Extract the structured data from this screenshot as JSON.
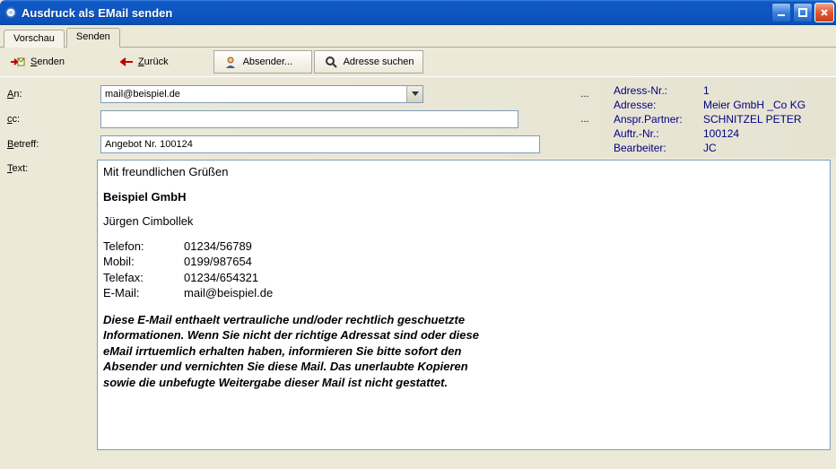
{
  "window": {
    "title": "Ausdruck als EMail senden"
  },
  "tabs": {
    "preview": "Vorschau",
    "send": "Senden"
  },
  "toolbar": {
    "send": "Senden",
    "back": "Zurück",
    "sender": "Absender...",
    "search": "Adresse suchen"
  },
  "form": {
    "labels": {
      "to": "An:",
      "cc": "cc:",
      "subject": "Betreff:",
      "text": "Text:",
      "ellipsis": "..."
    },
    "to_value": "mail@beispiel.de",
    "cc_value": "",
    "subject_value": "Angebot Nr. 100124"
  },
  "info": {
    "rows": [
      {
        "k": "Adress-Nr.:",
        "v": "1"
      },
      {
        "k": "Adresse:",
        "v": "Meier GmbH _Co KG"
      },
      {
        "k": "Anspr.Partner:",
        "v": "SCHNITZEL PETER"
      },
      {
        "k": "Auftr.-Nr.:",
        "v": "100124"
      },
      {
        "k": "Bearbeiter:",
        "v": "JC"
      }
    ]
  },
  "body": {
    "greeting": "Mit freundlichen Grüßen",
    "company": "Beispiel GmbH",
    "name": "Jürgen Cimbollek",
    "contacts": [
      {
        "k": "Telefon:",
        "v": "01234/56789"
      },
      {
        "k": "Mobil:",
        "v": "0199/987654"
      },
      {
        "k": "Telefax:",
        "v": "01234/654321"
      },
      {
        "k": "E-Mail:",
        "v": "mail@beispiel.de"
      }
    ],
    "legal": "Diese E-Mail enthaelt vertrauliche und/oder rechtlich geschuetzte Informationen. Wenn Sie nicht der richtige Adressat sind oder diese eMail irrtuemlich erhalten haben, informieren Sie bitte sofort den Absender und vernichten Sie diese Mail. Das unerlaubte Kopieren sowie die unbefugte Weitergabe dieser Mail ist nicht gestattet."
  }
}
